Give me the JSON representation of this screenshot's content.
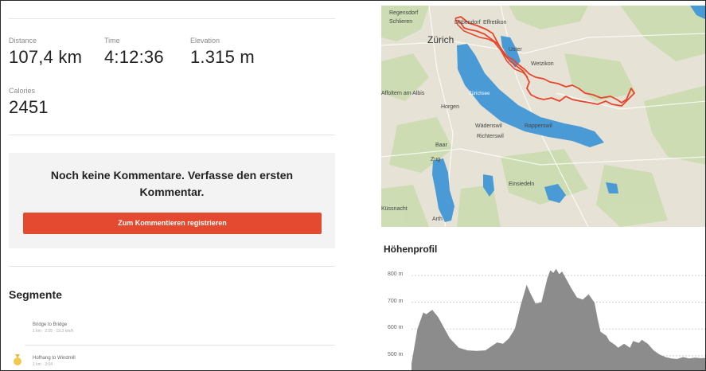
{
  "stats": {
    "distance": {
      "label": "Distance",
      "value": "107,4 km"
    },
    "time": {
      "label": "Time",
      "value": "4:12:36"
    },
    "elevation": {
      "label": "Elevation",
      "value": "1.315 m"
    },
    "calories": {
      "label": "Calories",
      "value": "2451"
    }
  },
  "comments": {
    "message": "Noch keine Kommentare. Verfasse den ersten Kommentar.",
    "register_button": "Zum Kommentieren registrieren"
  },
  "segments": {
    "title": "Segmente",
    "items": [
      {
        "name": "Bridge to Bridge",
        "meta": "1 km · 2:55 · 19,3 km/h"
      },
      {
        "name": "Hofhang to Windmill",
        "meta": "1 km · 3:04"
      }
    ]
  },
  "map": {
    "labels": [
      {
        "text": "Regensdorf",
        "icon": "city-dot"
      },
      {
        "text": "Schlieren",
        "icon": "city-dot"
      },
      {
        "text": "Dübendorf",
        "icon": "city-dot"
      },
      {
        "text": "Effretikon",
        "icon": "city-dot"
      },
      {
        "text": "Zürich",
        "icon": "city-dot"
      },
      {
        "text": "Uster",
        "icon": "city-dot"
      },
      {
        "text": "Wetzikon",
        "icon": "city-dot"
      },
      {
        "text": "Affoltern am Albis",
        "icon": "city-dot"
      },
      {
        "text": "Horgen",
        "icon": "city-dot"
      },
      {
        "text": "Zürichsee",
        "icon": "none"
      },
      {
        "text": "Wädenswil",
        "icon": "city-dot"
      },
      {
        "text": "Rapperswil",
        "icon": "city-dot"
      },
      {
        "text": "Richterswil",
        "icon": "city-dot"
      },
      {
        "text": "Baar",
        "icon": "city-dot"
      },
      {
        "text": "Zug",
        "icon": "city-dot"
      },
      {
        "text": "Einsiedeln",
        "icon": "city-dot"
      },
      {
        "text": "Küssnacht",
        "icon": "city-dot"
      },
      {
        "text": "Arth",
        "icon": "city-dot"
      }
    ],
    "route_color": "#e8442b",
    "water_color": "#4a9ad6",
    "land_color": "#e6e3d6",
    "forest_color": "#cbdcb0"
  },
  "elevation": {
    "title": "Höhenprofil",
    "y_ticks": [
      "800 m",
      "700 m",
      "600 m",
      "500 m"
    ],
    "fill_color": "#8c8c8c"
  },
  "chart_data": {
    "type": "area",
    "title": "Höhenprofil",
    "xlabel": "",
    "ylabel": "",
    "ylim": [
      440,
      830
    ],
    "y_ticks": [
      800,
      700,
      600,
      500
    ],
    "x_range": [
      0,
      100
    ],
    "grid": true,
    "series": [
      {
        "values": [
          [
            0,
            470
          ],
          [
            2,
            600
          ],
          [
            4,
            662
          ],
          [
            5,
            655
          ],
          [
            7,
            672
          ],
          [
            9,
            645
          ],
          [
            11,
            605
          ],
          [
            13,
            565
          ],
          [
            16,
            530
          ],
          [
            19,
            520
          ],
          [
            22,
            518
          ],
          [
            25,
            520
          ],
          [
            27,
            535
          ],
          [
            29,
            550
          ],
          [
            31,
            545
          ],
          [
            33,
            565
          ],
          [
            35,
            600
          ],
          [
            37,
            690
          ],
          [
            39,
            765
          ],
          [
            40,
            740
          ],
          [
            42,
            695
          ],
          [
            44,
            700
          ],
          [
            45,
            745
          ],
          [
            46,
            790
          ],
          [
            47,
            820
          ],
          [
            48,
            810
          ],
          [
            49,
            825
          ],
          [
            50,
            805
          ],
          [
            51,
            815
          ],
          [
            52,
            795
          ],
          [
            54,
            755
          ],
          [
            56,
            718
          ],
          [
            58,
            710
          ],
          [
            60,
            730
          ],
          [
            62,
            698
          ],
          [
            63,
            640
          ],
          [
            64,
            590
          ],
          [
            66,
            575
          ],
          [
            67,
            555
          ],
          [
            69,
            540
          ],
          [
            70,
            530
          ],
          [
            72,
            545
          ],
          [
            74,
            530
          ],
          [
            75,
            555
          ],
          [
            77,
            548
          ],
          [
            78,
            560
          ],
          [
            80,
            545
          ],
          [
            82,
            520
          ],
          [
            84,
            505
          ],
          [
            86,
            495
          ],
          [
            88,
            490
          ],
          [
            90,
            488
          ],
          [
            92,
            495
          ],
          [
            94,
            490
          ],
          [
            96,
            493
          ],
          [
            98,
            491
          ],
          [
            100,
            492
          ]
        ]
      }
    ]
  }
}
